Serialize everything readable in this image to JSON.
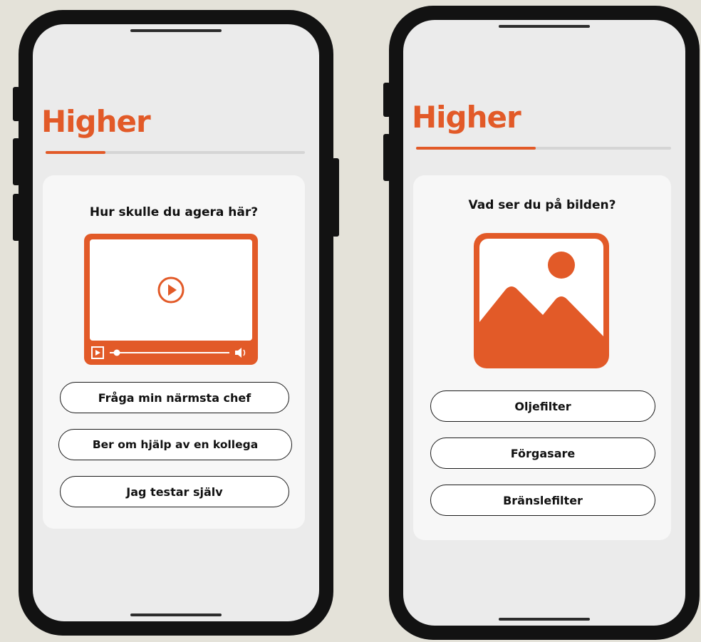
{
  "colors": {
    "accent": "#e25a28",
    "background": "#e4e2d9",
    "screen": "#ebebeb",
    "card": "#f7f7f7"
  },
  "phones": [
    {
      "logo": "Higher",
      "progress": 0.23,
      "question": "Hur skulle du agera här?",
      "media": "video-player",
      "answers": [
        "Fråga min närmsta chef",
        "Ber om hjälp av en kollega",
        "Jag testar själv"
      ]
    },
    {
      "logo": "Higher",
      "progress": 0.47,
      "question": "Vad ser du på bilden?",
      "media": "image-icon",
      "answers": [
        "Oljefilter",
        "Förgasare",
        "Bränslefilter"
      ]
    }
  ]
}
